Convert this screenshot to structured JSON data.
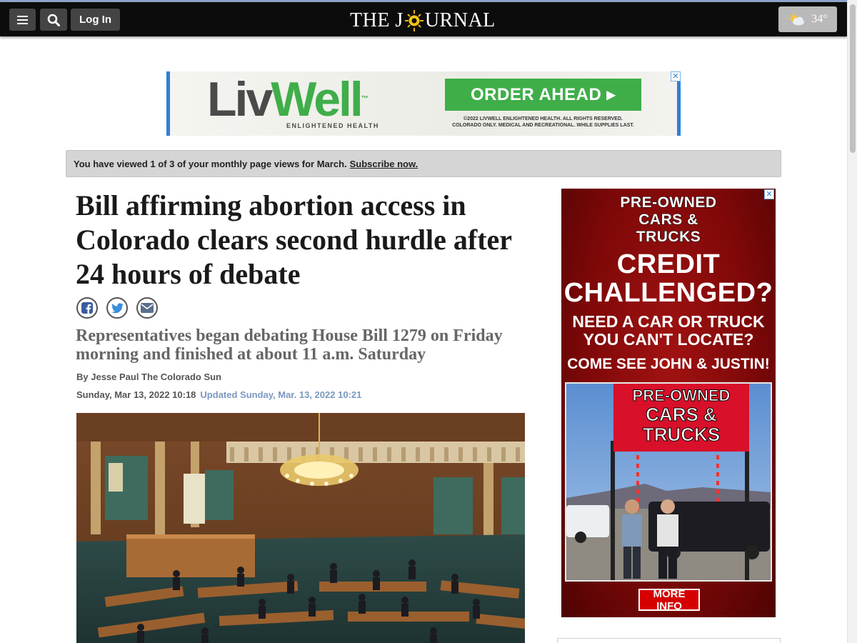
{
  "header": {
    "login_label": "Log In",
    "logo_text_left": "THE J",
    "logo_text_right": "URNAL",
    "weather_icon": "partly-cloudy-icon",
    "temperature": "34°"
  },
  "leaderboard_ad": {
    "brand_part1": "Liv",
    "brand_part2": "Well",
    "trademark": "™",
    "tagline": "ENLIGHTENED HEALTH",
    "cta": "ORDER AHEAD ▸",
    "legal_line1": "©2022 LIVWELL ENLIGHTENED HEALTH. ALL RIGHTS RESERVED.",
    "legal_line2": "COLORADO ONLY. MEDICAL AND RECREATIONAL. WHILE SUPPLIES LAST.",
    "brand_green": "#3fae49",
    "close_label": "✕"
  },
  "notice": {
    "text": "You have viewed 1 of 3 of your monthly page views for March.",
    "link": "Subscribe now."
  },
  "article": {
    "headline": "Bill affirming abortion access in Colorado clears second hurdle after 24 hours of debate",
    "subhead": "Representatives began debating House Bill 1279 on Friday morning and finished at about 11 a.m. Saturday",
    "byline": "By Jesse Paul The Colorado Sun",
    "published": "Sunday, Mar 13, 2022 10:18",
    "updated": "Updated Sunday, Mar. 13, 2022 10:21",
    "share_icons": [
      "facebook-icon",
      "twitter-icon",
      "email-icon"
    ]
  },
  "side_ad": {
    "line1": "PRE-OWNED",
    "line2": "CARS &",
    "line3": "TRUCKS",
    "credit1": "CREDIT",
    "credit2": "CHALLENGED?",
    "need1": "NEED A CAR OR TRUCK",
    "need2": "YOU CAN'T LOCATE?",
    "come": "COME SEE JOHN & JUSTIN!",
    "sign1": "PRE-OWNED",
    "sign2": "CARS &",
    "sign3": "TRUCKS",
    "cta": "MORE INFO",
    "close_label": "✕"
  }
}
